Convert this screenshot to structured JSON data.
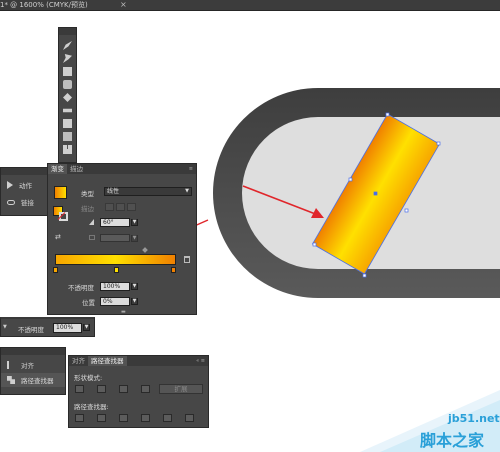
{
  "document_tab": {
    "title": "1* @ 1600% (CMYK/预览)",
    "close_glyph": "×"
  },
  "left_panel": {
    "items": [
      {
        "label": "动作",
        "icon": "play-icon"
      },
      {
        "label": "链接",
        "icon": "link-icon"
      }
    ]
  },
  "gradient_panel": {
    "tabs": [
      {
        "label": "渐变"
      },
      {
        "label": "描边"
      }
    ],
    "type_label": "类型",
    "type_value": "线性",
    "stroke_label": "描边",
    "angle_value": "60°",
    "opacity_label": "不透明度",
    "opacity_value": "100%",
    "location_label": "位置",
    "location_value": "0%",
    "gradient_colors": {
      "start": "#f7a600",
      "mid": "#ffe000",
      "end": "#f08000"
    }
  },
  "opacity_bar": {
    "label": "不透明度",
    "value": "100%"
  },
  "side_list": {
    "items": [
      {
        "label": "对齐"
      },
      {
        "label": "路径查找器"
      }
    ]
  },
  "pathfinder_panel": {
    "tabs": [
      {
        "label": "对齐"
      },
      {
        "label": "路径查找器"
      }
    ],
    "shape_modes_label": "形状模式:",
    "expand_label": "扩展",
    "pathfinders_label": "路径查找器:"
  },
  "canvas": {
    "shape_colors": {
      "outer": "#4b4b4b",
      "inner": "#dedede",
      "arrow": "#e0262b",
      "selection": "#4a6ee8"
    }
  },
  "watermark": {
    "site": "jb51.net",
    "name": "脚本之家"
  }
}
